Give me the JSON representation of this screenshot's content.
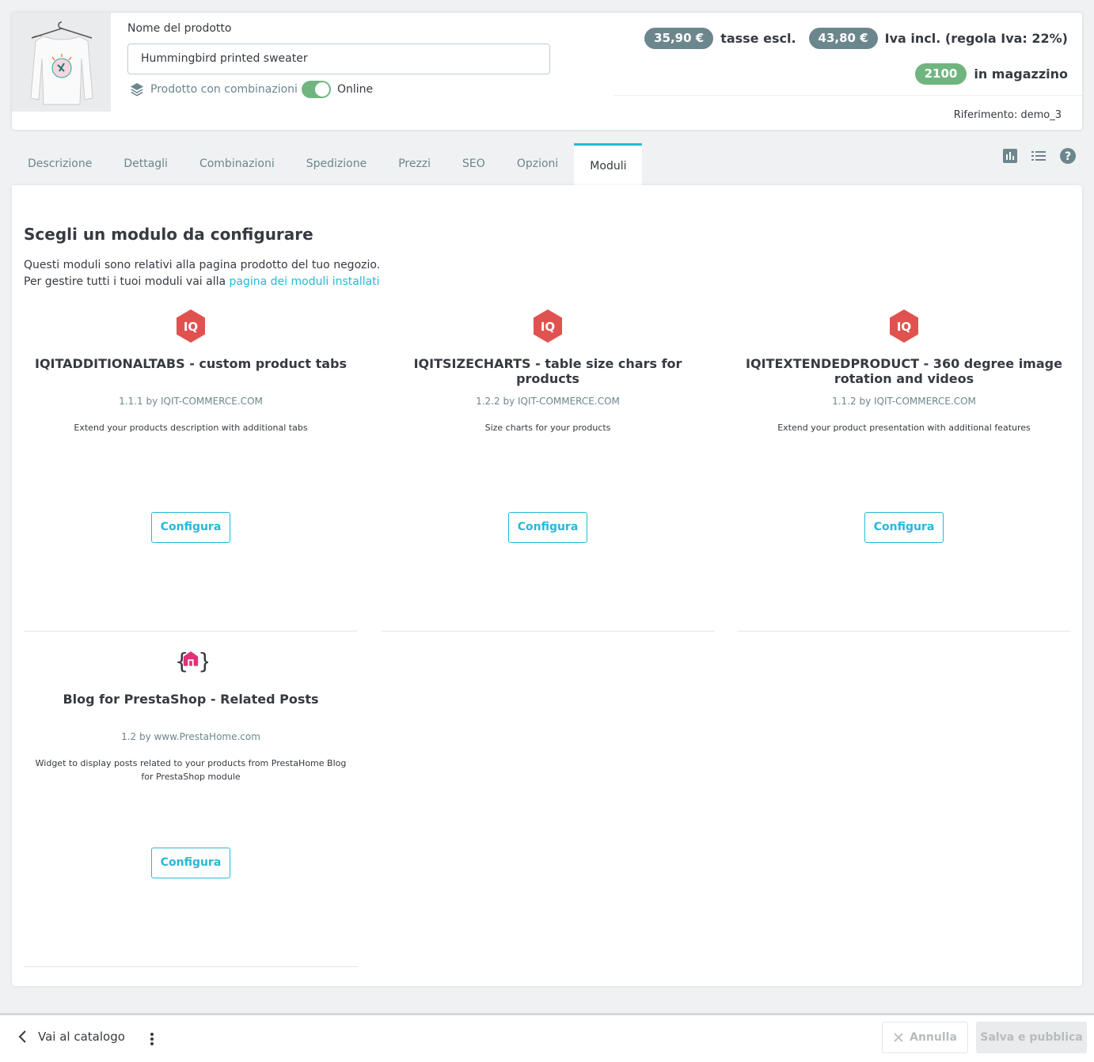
{
  "header": {
    "name_label": "Nome del prodotto",
    "name_value": "Hummingbird printed sweater",
    "combination_label": "Prodotto con combinazioni",
    "online_label": "Online",
    "price_excl": "35,90 €",
    "price_excl_label": "tasse escl.",
    "price_incl": "43,80 €",
    "price_incl_label": "Iva incl. (regola Iva: 22%)",
    "stock": "2100",
    "stock_label": "in magazzino",
    "reference": "Riferimento: demo_3"
  },
  "tabs": [
    "Descrizione",
    "Dettagli",
    "Combinazioni",
    "Spedizione",
    "Prezzi",
    "SEO",
    "Opzioni",
    "Moduli"
  ],
  "active_tab": "Moduli",
  "main": {
    "title": "Scegli un modulo da configurare",
    "intro_line1": "Questi moduli sono relativi alla pagina prodotto del tuo negozio.",
    "intro_line2": "Per gestire tutti i tuoi moduli vai alla",
    "intro_link": "pagina dei moduli installati"
  },
  "modules": [
    {
      "title": "IQITADDITIONALTABS - custom product tabs",
      "meta": "1.1.1 by IQIT-COMMERCE.COM",
      "desc": "Extend your products description with additional tabs",
      "button": "Configura",
      "icon": "iq-logo-icon"
    },
    {
      "title": "IQITSIZECHARTS - table size chars for products",
      "meta": "1.2.2 by IQIT-COMMERCE.COM",
      "desc": "Size charts for your products",
      "button": "Configura",
      "icon": "iq-logo-icon"
    },
    {
      "title": "IQITEXTENDEDPRODUCT - 360 degree image rotation and videos",
      "meta": "1.1.2 by IQIT-COMMERCE.COM",
      "desc": "Extend your product presentation with additional features",
      "button": "Configura",
      "icon": "iq-logo-icon"
    },
    {
      "title": "Blog for PrestaShop - Related Posts",
      "meta": "1.2 by www.PrestaHome.com",
      "desc": "Widget to display posts related to your products from PrestaHome Blog for PrestaShop module",
      "button": "Configura",
      "icon": "prestahome-logo-icon"
    }
  ],
  "footer": {
    "back_label": "Vai al catalogo",
    "cancel_label": "Annulla",
    "save_label": "Salva e pubblica"
  },
  "colors": {
    "accent": "#25b9d7",
    "success": "#70b580",
    "badge": "#6c868e",
    "iq_red": "#e0524f"
  }
}
